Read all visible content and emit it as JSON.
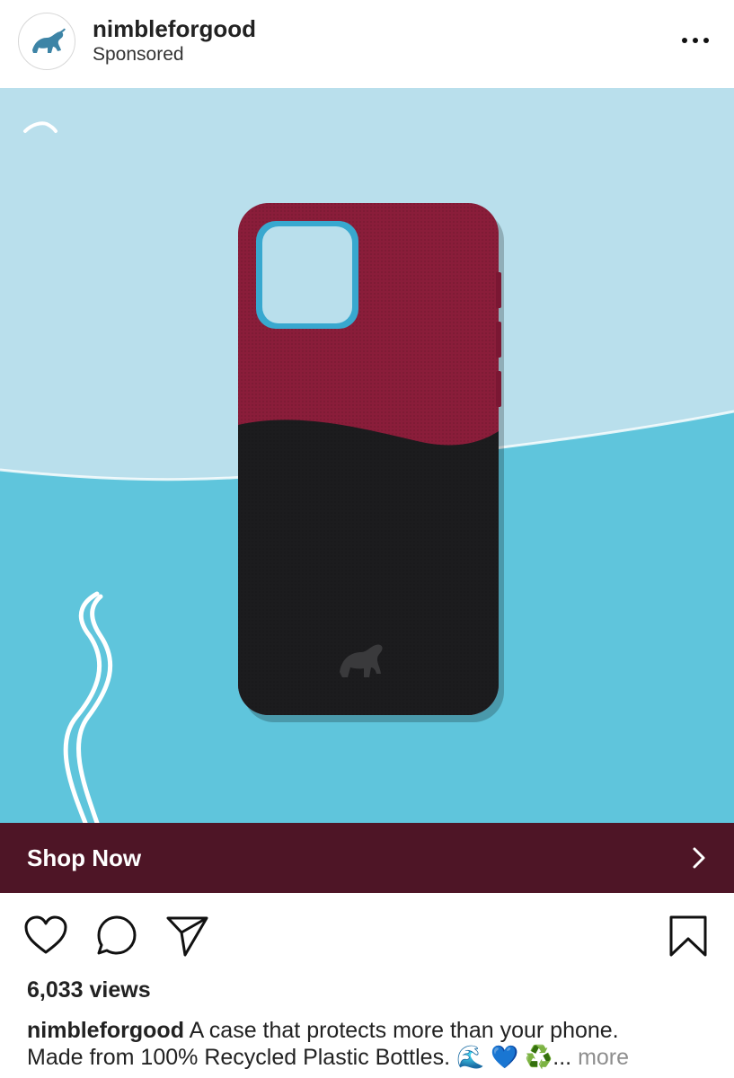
{
  "post": {
    "username": "nimbleforgood",
    "sponsored_label": "Sponsored",
    "cta_label": "Shop Now",
    "views": "6,033 views",
    "caption_line1": "A case that protects more than your phone.",
    "caption_line2": "Made from 100% Recycled Plastic Bottles. 🌊 💙 ♻️",
    "caption_more_ellipsis": "...",
    "caption_more": "more"
  },
  "icons": {
    "avatar": "elephant-logo-icon",
    "menu": "more-options-icon",
    "collapse": "chevron-up-icon",
    "cta_arrow": "chevron-right-icon",
    "like": "heart-icon",
    "comment": "comment-bubble-icon",
    "share": "paper-plane-icon",
    "save": "bookmark-icon"
  },
  "colors": {
    "cta_bar": "#4e1526",
    "sky": "#b9dfec",
    "water": "#5fc5dc",
    "case_top": "#8a1d3a",
    "case_bottom": "#1c1c1e",
    "camera_trim": "#38a8cf"
  }
}
